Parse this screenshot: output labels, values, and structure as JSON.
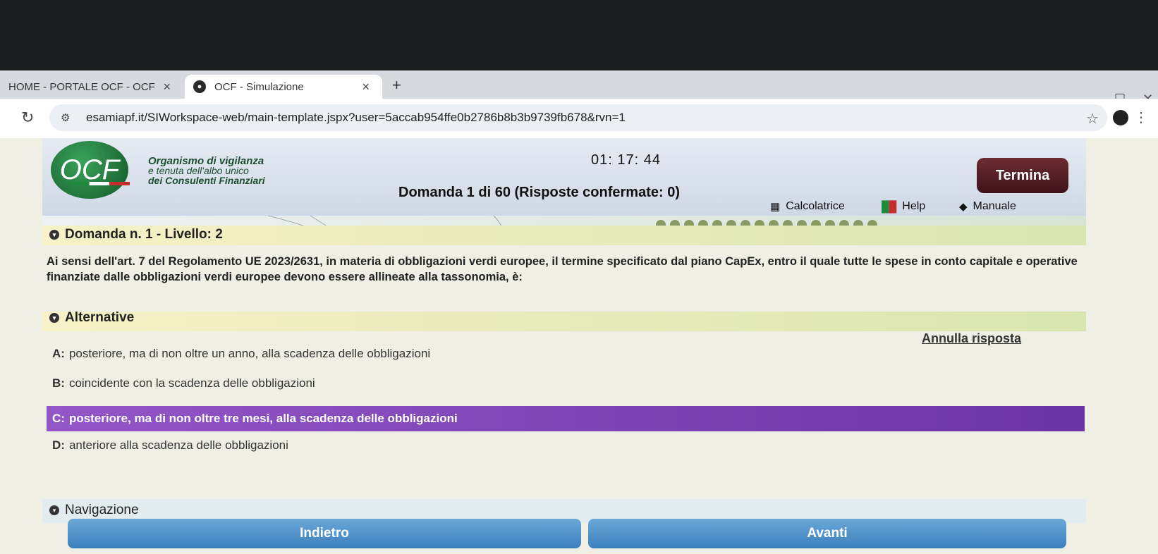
{
  "browser": {
    "tabs": [
      {
        "title": "HOME - PORTALE OCF - OCF",
        "close": "×"
      },
      {
        "title": "OCF - Simulazione",
        "close": "×"
      }
    ],
    "new_tab": "+",
    "url": "esamiapf.it/SIWorkspace-web/main-template.jspx?user=5accab954ffe0b2786b8b3b9739fb678&rvn=1"
  },
  "header": {
    "logo_text": "OCF",
    "org_line1": "Organismo di vigilanza",
    "org_line2": "e tenuta dell'albo unico",
    "org_line3": "dei Consulenti Finanziari",
    "timer": "01: 17: 44",
    "question_counter": "Domanda 1 di 60 (Risposte confermate: 0)",
    "termina_label": "Termina",
    "tools": [
      {
        "label": "Calcolatrice",
        "icon": "calculator-icon"
      },
      {
        "label": "Help",
        "icon": "italian-flag-icon"
      },
      {
        "label": "Manuale",
        "icon": "book-icon"
      }
    ]
  },
  "question": {
    "section_title": "Domanda n. 1 - Livello: 2",
    "text": "Ai sensi dell'art. 7 del Regolamento UE 2023/2631, in materia di obbligazioni verdi europee, il termine specificato dal piano CapEx, entro il quale tutte le spese in conto capitale e operative finanziate dalle obbligazioni verdi europee devono essere allineate alla tassonomia, è:"
  },
  "alternatives": {
    "section_title": "Alternative",
    "annulla_label": "Annulla risposta",
    "selected": "C",
    "items": [
      {
        "letter": "A:",
        "text": "posteriore, ma di non oltre un anno, alla scadenza delle obbligazioni"
      },
      {
        "letter": "B:",
        "text": "coincidente con la scadenza delle obbligazioni"
      },
      {
        "letter": "C:",
        "text": "posteriore, ma di non oltre tre mesi, alla scadenza delle obbligazioni"
      },
      {
        "letter": "D:",
        "text": "anteriore alla scadenza delle obbligazioni"
      }
    ]
  },
  "navigation": {
    "section_title": "Navigazione",
    "back_label": "Indietro",
    "next_label": "Avanti"
  },
  "colors": {
    "selected_answer": "#7e44b8",
    "termina": "#5a2228",
    "nav_button": "#4a8cc8"
  }
}
